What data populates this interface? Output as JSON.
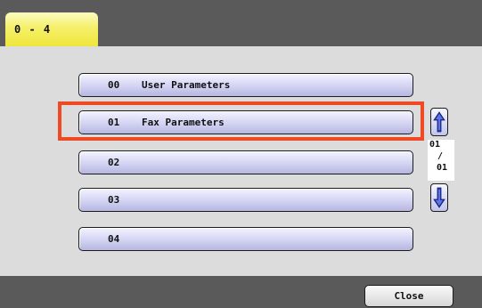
{
  "header": {
    "tab_label": "0 - 4"
  },
  "list": {
    "items": [
      {
        "number": "00",
        "label": "User Parameters"
      },
      {
        "number": "01",
        "label": "Fax Parameters"
      },
      {
        "number": "02",
        "label": ""
      },
      {
        "number": "03",
        "label": ""
      },
      {
        "number": "04",
        "label": ""
      }
    ],
    "highlighted_index": 1
  },
  "pager": {
    "current_page": "01",
    "separator": "/",
    "total_pages": "01",
    "up_icon": "arrow-up-icon",
    "down_icon": "arrow-down-icon"
  },
  "footer": {
    "close_label": "Close"
  },
  "colors": {
    "bar": "#5a5a5a",
    "tab": "#f5f06a",
    "item_fill": "#d3d3f3",
    "highlight": "#f04a24"
  }
}
